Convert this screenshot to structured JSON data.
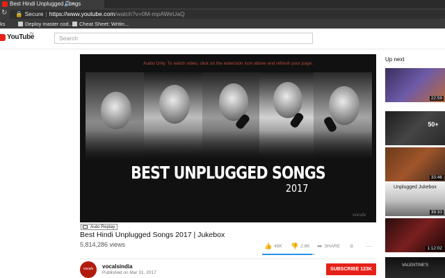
{
  "browser": {
    "tab_title": "Best Hindi Unplugged Songs",
    "audio_icon": "speaker-icon",
    "close_glyph": "×",
    "omnibox": {
      "secure_label": "Secure",
      "separator": "|",
      "url_host": "https://www.youtube.com",
      "url_path": "/watch?v=0M-mpAWeUaQ"
    },
    "bookmarks": [
      {
        "label": "ks"
      },
      {
        "label": "Deploy master cod..."
      },
      {
        "label": "Cheat Sheet: Writin..."
      }
    ]
  },
  "header": {
    "logo_text": "YouTube",
    "logo_region": "IN",
    "search_placeholder": "Search"
  },
  "player": {
    "notice": "Audio Only. To watch video, click on the extension icon above and refresh your page.",
    "thumbnail_title": "BEST UNPLUGGED SONGS",
    "thumbnail_year": "2017",
    "watermark": "vocals"
  },
  "video": {
    "auto_replay_label": "Auto Replay",
    "title": "Best Hindi Unplugged Songs 2017 | Jukebox",
    "views": "5,814,286 views",
    "likes": "48K",
    "dislikes": "2.8K",
    "share_label": "SHARE",
    "like_ratio_percent": 94.6
  },
  "channel": {
    "name": "vocalsindia",
    "published": "Published on Mar 31, 2017",
    "avatar_text": "vocals",
    "subscribe_label": "SUBSCRIBE",
    "subscriber_count": "123K"
  },
  "sidebar": {
    "heading": "Up next",
    "items": [
      {
        "duration": "22:59",
        "caption": ""
      },
      {
        "duration": "",
        "caption": "50+"
      },
      {
        "duration": "33:46",
        "caption": ""
      },
      {
        "duration": "39:33",
        "caption": "Unplugged Jukebox"
      },
      {
        "duration": "1:12:02",
        "caption": ""
      },
      {
        "duration": "",
        "caption": "VALENTINE'S"
      }
    ]
  },
  "colors": {
    "brand_red": "#e62117",
    "like_bar": "#2793e6",
    "notice_text": "#b84b3a"
  }
}
